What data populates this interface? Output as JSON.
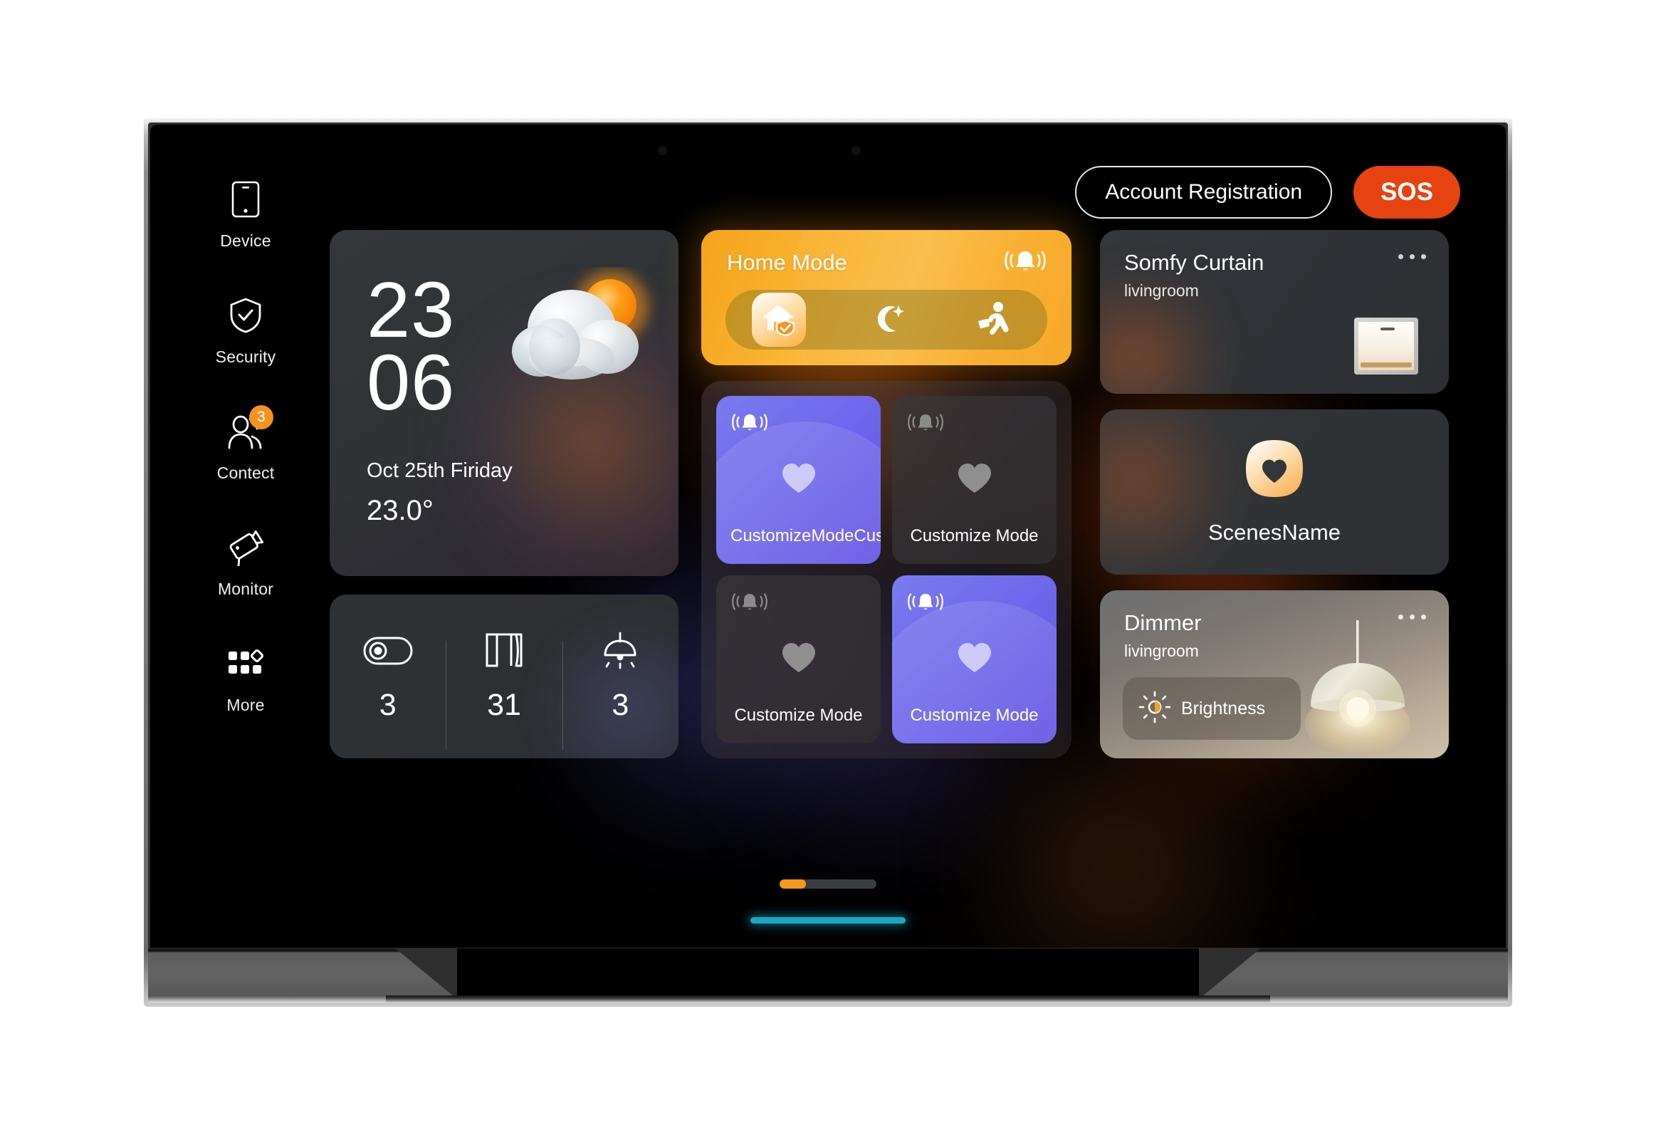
{
  "sidebar": {
    "items": [
      {
        "label": "Device",
        "icon": "tablet-icon",
        "badge": null
      },
      {
        "label": "Security",
        "icon": "shield-check-icon",
        "badge": null
      },
      {
        "label": "Contect",
        "icon": "contacts-icon",
        "badge": "3"
      },
      {
        "label": "Monitor",
        "icon": "camera-icon",
        "badge": null
      },
      {
        "label": "More",
        "icon": "grid-more-icon",
        "badge": null
      }
    ]
  },
  "header": {
    "account_registration_label": "Account Registration",
    "sos_label": "SOS"
  },
  "clock_card": {
    "hours": "23",
    "minutes": "06",
    "date": "Oct 25th Firiday",
    "temperature": "23.0°",
    "weather_icon": "partly-cloudy-icon"
  },
  "stats_card": {
    "stats": [
      {
        "icon": "switch-toggle-icon",
        "value": "3"
      },
      {
        "icon": "curtain-icon",
        "value": "31"
      },
      {
        "icon": "pendant-light-icon",
        "value": "3"
      }
    ]
  },
  "home_mode_card": {
    "title": "Home Mode",
    "bell_icon": "bell-ringing-icon",
    "modes": [
      {
        "name": "home-mode",
        "icon": "home-shield-icon",
        "active": true
      },
      {
        "name": "night-mode",
        "icon": "moon-star-icon",
        "active": false
      },
      {
        "name": "away-mode",
        "icon": "person-running-icon",
        "active": false
      }
    ]
  },
  "customize_panel": {
    "tiles": [
      {
        "label": "CustomizeModeCustomizeModed...",
        "active": true,
        "bell_icon": "bell-ringing-icon",
        "heart_icon": "heart-icon"
      },
      {
        "label": "Customize Mode",
        "active": false,
        "bell_icon": "bell-ringing-icon",
        "heart_icon": "heart-icon"
      },
      {
        "label": "Customize Mode",
        "active": false,
        "bell_icon": "bell-ringing-icon",
        "heart_icon": "heart-icon"
      },
      {
        "label": "Customize Mode",
        "active": true,
        "bell_icon": "bell-ringing-icon",
        "heart_icon": "heart-icon"
      }
    ]
  },
  "somfy_card": {
    "title": "Somfy Curtain",
    "subtitle": "livingroom",
    "more_icon": "more-dots-icon",
    "device_icon": "curtain-switch-icon"
  },
  "scenes_card": {
    "label": "ScenesName",
    "icon": "heart-squircle-icon"
  },
  "dimmer_card": {
    "title": "Dimmer",
    "subtitle": "livingroom",
    "more_icon": "more-dots-icon",
    "brightness_label": "Brightness",
    "brightness_icon": "sun-brightness-icon",
    "device_icon": "pendant-lamp-icon"
  },
  "page_indicator": {
    "current_page": "1",
    "total_pages": "4"
  },
  "colors": {
    "accent_orange": "#f59a18",
    "sos_red": "#e74310",
    "mode_purple": "#6f6aec",
    "home_indicator_cyan": "#17a8c4",
    "badge_orange": "#f59220"
  }
}
